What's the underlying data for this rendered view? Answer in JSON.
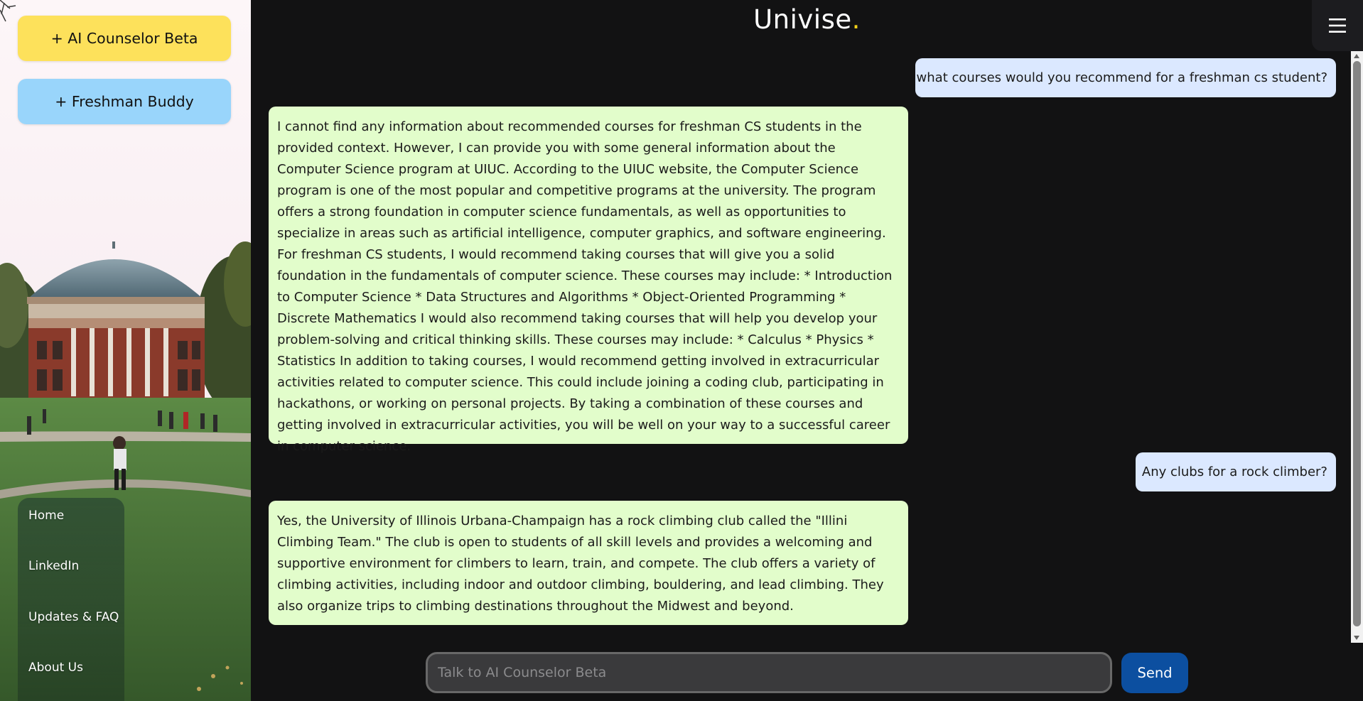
{
  "app": {
    "title": "Univise",
    "title_dot": "."
  },
  "sidebar": {
    "new_chat_buttons": [
      {
        "label": "+ AI Counselor Beta",
        "color": "#fde15b"
      },
      {
        "label": "+ Freshman Buddy",
        "color": "#99d5fb"
      }
    ],
    "background": {
      "description": "campus photo with domed building",
      "sky_color": "#fbf3f6",
      "grass_color": "#4f7a38"
    },
    "nav_items": [
      {
        "label": "Home"
      },
      {
        "label": "LinkedIn"
      },
      {
        "label": "Updates & FAQ"
      },
      {
        "label": "About Us"
      }
    ]
  },
  "header": {
    "menu_icon": "hamburger-menu-icon"
  },
  "chat": {
    "messages": [
      {
        "role": "user",
        "text": "what courses would you recommend for a freshman cs student?"
      },
      {
        "role": "assistant",
        "text": "I cannot find any information about recommended courses for freshman CS students in the provided context. However, I can provide you with some general information about the Computer Science program at UIUC. According to the UIUC website, the Computer Science program is one of the most popular and competitive programs at the university. The program offers a strong foundation in computer science fundamentals, as well as opportunities to specialize in areas such as artificial intelligence, computer graphics, and software engineering. For freshman CS students, I would recommend taking courses that will give you a solid foundation in the fundamentals of computer science. These courses may include: * Introduction to Computer Science * Data Structures and Algorithms * Object-Oriented Programming * Discrete Mathematics I would also recommend taking courses that will help you develop your problem-solving and critical thinking skills. These courses may include: * Calculus * Physics * Statistics In addition to taking courses, I would recommend getting involved in extracurricular activities related to computer science. This could include joining a coding club, participating in hackathons, or working on personal projects. By taking a combination of these courses and getting involved in extracurricular activities, you will be well on your way to a successful career in computer science."
      },
      {
        "role": "user",
        "text": "Any clubs for a rock climber?"
      },
      {
        "role": "assistant",
        "text": "Yes, the University of Illinois Urbana-Champaign has a rock climbing club called the \"Illini Climbing Team.\" The club is open to students of all skill levels and provides a welcoming and supportive environment for climbers to learn, train, and compete. The club offers a variety of climbing activities, including indoor and outdoor climbing, bouldering, and lead climbing. They also organize trips to climbing destinations throughout the Midwest and beyond."
      }
    ],
    "colors": {
      "user_bubble": "#dbe8ff",
      "assistant_bubble": "#e2fdcb",
      "background": "#121213"
    }
  },
  "composer": {
    "input_placeholder": "Talk to AI Counselor Beta",
    "input_value": "",
    "send_label": "Send",
    "send_color": "#0c4fa0"
  }
}
